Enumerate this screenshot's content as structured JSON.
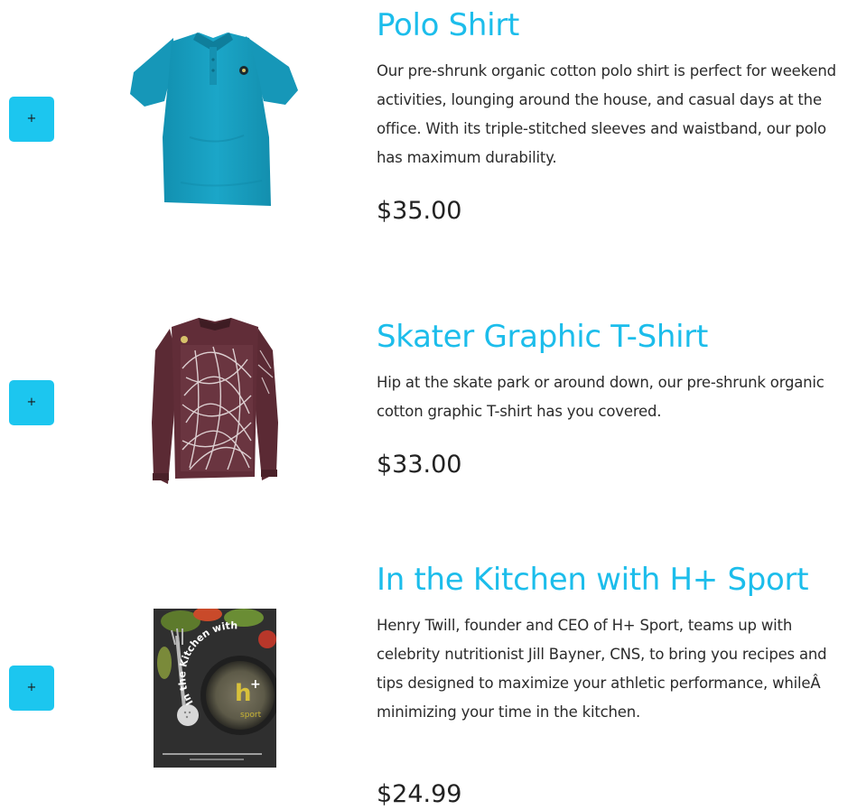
{
  "products": [
    {
      "title": "Polo Shirt",
      "description": "Our pre-shrunk organic cotton polo shirt is perfect for weekend activities, lounging around the house, and casual days at the office. With its triple-stitched sleeves and waistband, our polo has maximum durability.",
      "price": "$35.00",
      "add_label": "+",
      "image": "polo-shirt-photo",
      "image_color": "#1aa3c4"
    },
    {
      "title": "Skater Graphic T-Shirt",
      "description": "Hip at the skate park or around down, our pre-shrunk organic cotton graphic T-shirt has you covered.",
      "price": "$33.00",
      "add_label": "+",
      "image": "graphic-long-sleeve-shirt-photo",
      "image_color": "#5e2b35"
    },
    {
      "title": "In the Kitchen with H+ Sport",
      "description": "Henry Twill, founder and CEO of H+ Sport, teams up with celebrity nutritionist Jill Bayner, CNS, to bring you recipes and tips designed to maximize your athletic performance, whileÂ minimizing your time in the kitchen.",
      "price": "$24.99",
      "add_label": "+",
      "image": "cookbook-cover-photo",
      "cover_title": "In the Kitchen with",
      "cover_logo_main": "h",
      "cover_logo_sup": "+",
      "cover_logo_sub": "sport",
      "image_color": "#3a3a3a"
    }
  ],
  "colors": {
    "accent": "#1cc6ef",
    "title": "#1cbdeb",
    "text": "#2b2b2b",
    "price": "#222222"
  }
}
